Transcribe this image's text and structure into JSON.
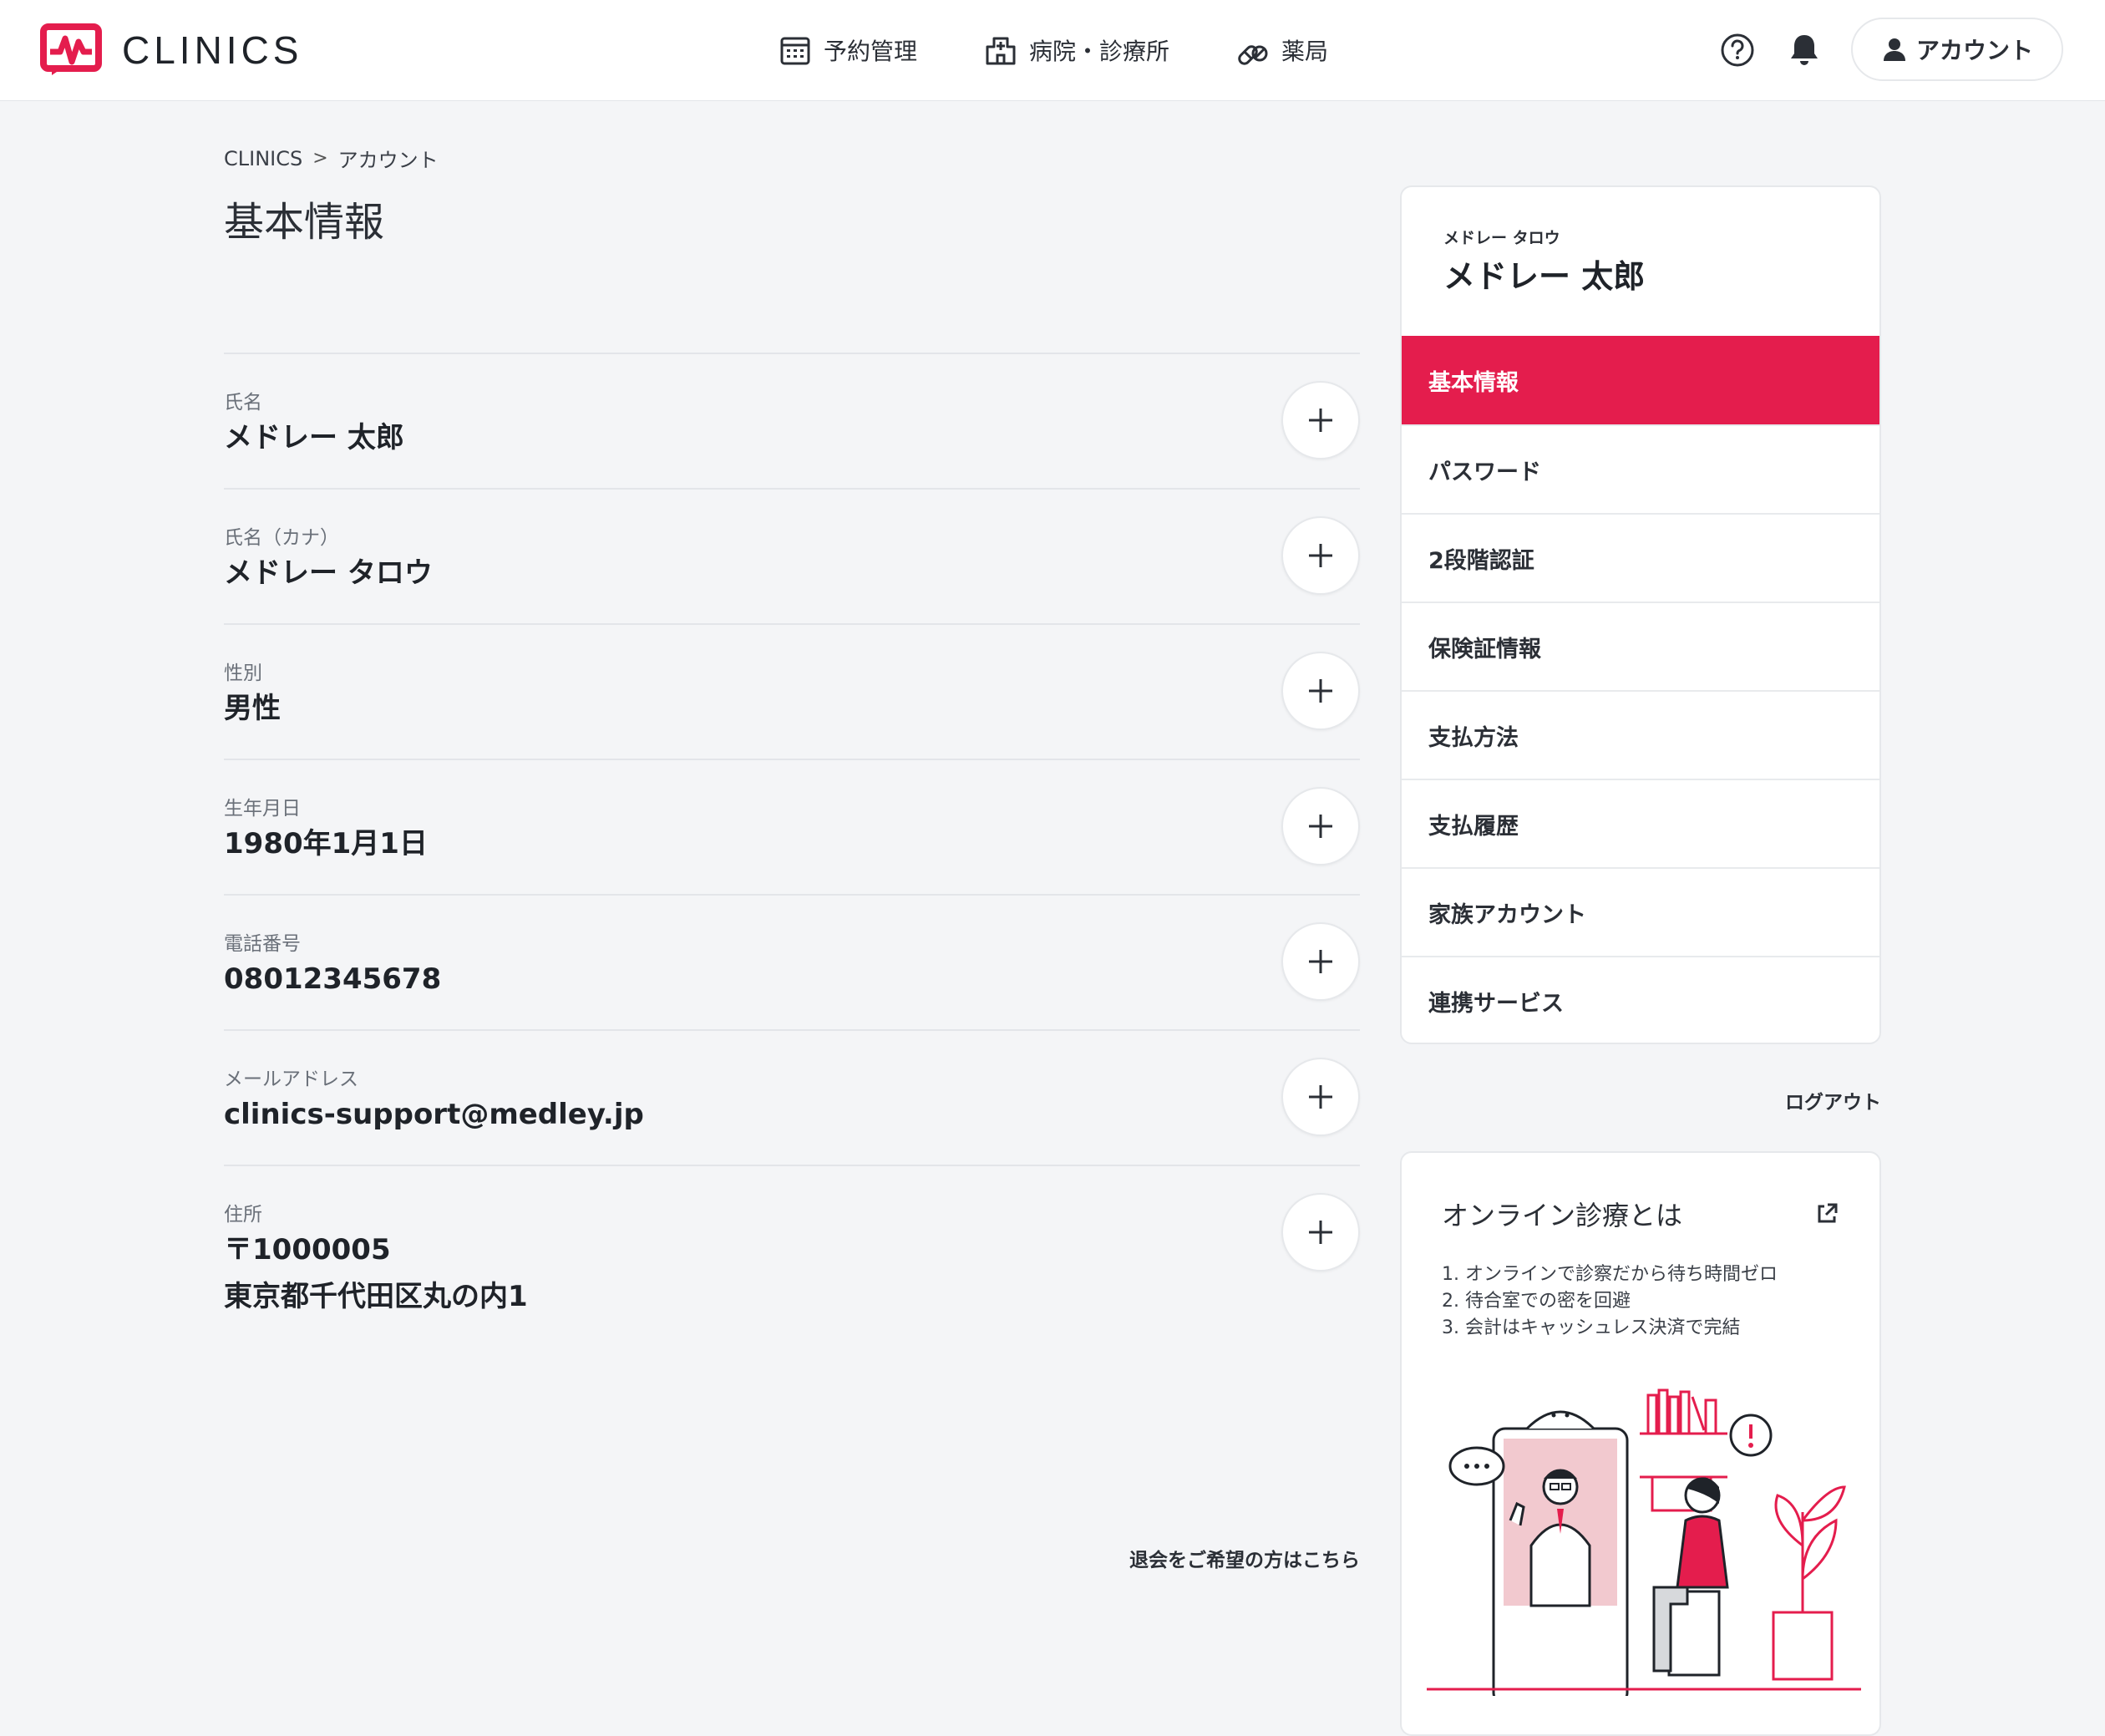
{
  "header": {
    "logo_text": "CLINICS",
    "nav": [
      {
        "label": "予約管理",
        "icon": "calendar-icon"
      },
      {
        "label": "病院・診療所",
        "icon": "hospital-icon"
      },
      {
        "label": "薬局",
        "icon": "pill-icon"
      }
    ],
    "help_icon": "help-circle-icon",
    "bell_icon": "bell-icon",
    "account_label": "アカウント"
  },
  "breadcrumb": {
    "root": "CLINICS",
    "separator": ">",
    "current": "アカウント"
  },
  "page_title": "基本情報",
  "fields": [
    {
      "label": "氏名",
      "value": "メドレー 太郎"
    },
    {
      "label": "氏名（カナ）",
      "value": "メドレー タロウ"
    },
    {
      "label": "性別",
      "value": "男性"
    },
    {
      "label": "生年月日",
      "value": "1980年1月1日"
    },
    {
      "label": "電話番号",
      "value": "08012345678"
    },
    {
      "label": "メールアドレス",
      "value": "clinics-support@medley.jp"
    },
    {
      "label": "住所",
      "value_line1": "〒1000005",
      "value_line2": "東京都千代田区丸の内1"
    }
  ],
  "withdraw_link": "退会をご希望の方はこちら",
  "profile": {
    "kana": "メドレー タロウ",
    "name": "メドレー 太郎"
  },
  "menu": [
    {
      "label": "基本情報",
      "active": true
    },
    {
      "label": "パスワード"
    },
    {
      "label": "2段階認証"
    },
    {
      "label": "保険証情報"
    },
    {
      "label": "支払方法"
    },
    {
      "label": "支払履歴"
    },
    {
      "label": "家族アカウント"
    },
    {
      "label": "連携サービス"
    }
  ],
  "logout": "ログアウト",
  "promo": {
    "title": "オンライン診療とは",
    "points": [
      "1. オンラインで診察だから待ち時間ゼロ",
      "2. 待合室での密を回避",
      "3. 会計はキャッシュレス決済で完結"
    ]
  },
  "colors": {
    "brand": "#e41d4d",
    "background": "#f4f5f7",
    "text": "#2b2f36"
  }
}
